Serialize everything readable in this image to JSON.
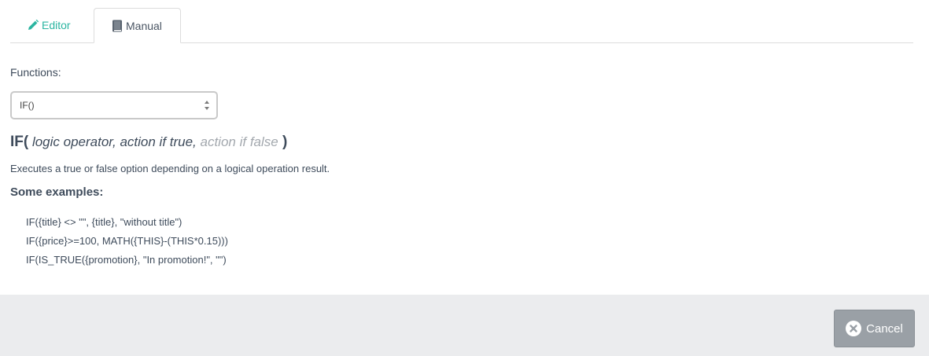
{
  "tabs": {
    "editor": {
      "label": "Editor",
      "icon": "pencil-icon",
      "color": "#2bb5a1"
    },
    "manual": {
      "label": "Manual",
      "icon": "book-icon",
      "active": true
    }
  },
  "functions": {
    "label": "Functions:",
    "selected": "IF()"
  },
  "signature": {
    "name": "IF(",
    "args": " logic operator, action if true,",
    "optional": " action if false",
    "close": " )"
  },
  "description": "Executes a true or false option depending on a logical operation result.",
  "examples": {
    "title": "Some examples:",
    "items": [
      "IF({title} <> \"\", {title}, \"without title\")",
      "IF({price}>=100, MATH({THIS}-(THIS*0.15)))",
      "IF(IS_TRUE({promotion}, \"In promotion!\", \"\")"
    ]
  },
  "footer": {
    "cancel_label": "Cancel",
    "cancel_icon": "close-circle-icon"
  }
}
